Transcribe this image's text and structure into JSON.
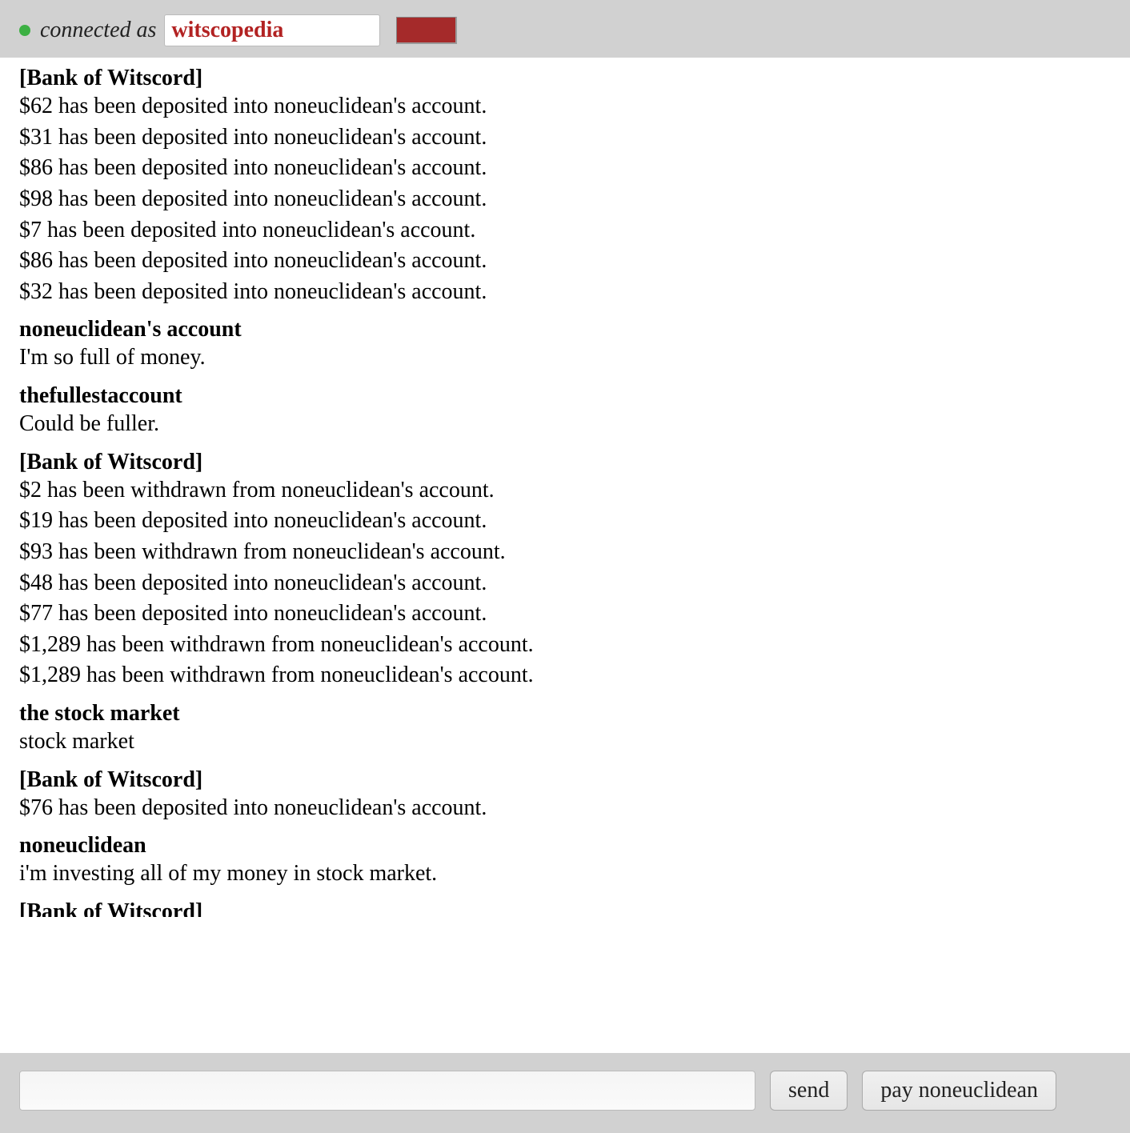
{
  "header": {
    "connected_label": "connected as",
    "username_value": "witscopedia"
  },
  "messages": [
    {
      "sender": "[Bank of Witscord]",
      "lines": [
        "$62 has been deposited into noneuclidean's account.",
        "$31 has been deposited into noneuclidean's account.",
        "$86 has been deposited into noneuclidean's account.",
        "$98 has been deposited into noneuclidean's account.",
        "$7 has been deposited into noneuclidean's account.",
        "$86 has been deposited into noneuclidean's account.",
        "$32 has been deposited into noneuclidean's account."
      ]
    },
    {
      "sender": "noneuclidean's account",
      "lines": [
        "I'm so full of money."
      ]
    },
    {
      "sender": "thefullestaccount",
      "lines": [
        "Could be fuller."
      ]
    },
    {
      "sender": "[Bank of Witscord]",
      "lines": [
        "$2 has been withdrawn from noneuclidean's account.",
        "$19 has been deposited into noneuclidean's account.",
        "$93 has been withdrawn from noneuclidean's account.",
        "$48 has been deposited into noneuclidean's account.",
        "$77 has been deposited into noneuclidean's account.",
        "$1,289 has been withdrawn from noneuclidean's account.",
        "$1,289 has been withdrawn from noneuclidean's account."
      ]
    },
    {
      "sender": "the stock market",
      "lines": [
        "stock market"
      ]
    },
    {
      "sender": "[Bank of Witscord]",
      "lines": [
        "$76 has been deposited into noneuclidean's account."
      ]
    },
    {
      "sender": "noneuclidean",
      "lines": [
        "i'm investing all of my money in stock market."
      ]
    }
  ],
  "cutoff_sender": "[Bank of Witscord]",
  "footer": {
    "message_value": "",
    "send_label": "send",
    "pay_label": "pay noneuclidean"
  }
}
